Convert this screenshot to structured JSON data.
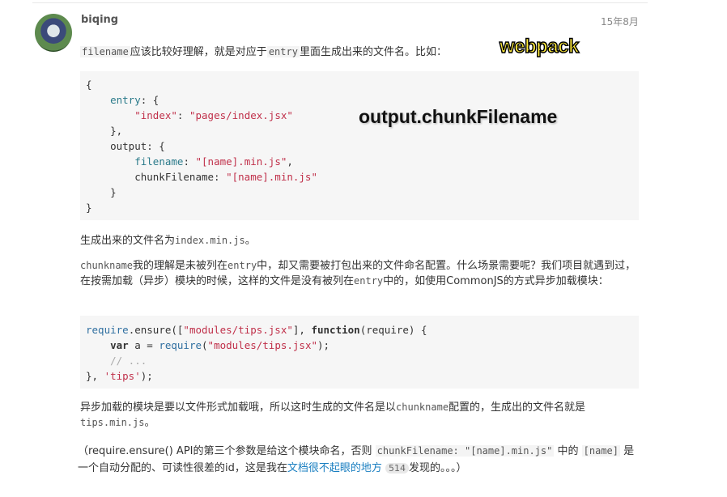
{
  "comment": {
    "author": "biqing",
    "date": "15年8月"
  },
  "p1": {
    "code1": "filename",
    "t1": "应该比较好理解，就是对应于",
    "code2": "entry",
    "t2": "里面生成出来的文件名。比如："
  },
  "code_block_1": [
    [
      {
        "t": "{",
        "c": ""
      }
    ],
    [
      {
        "t": "    ",
        "c": ""
      },
      {
        "t": "entry",
        "c": "k"
      },
      {
        "t": ": {",
        "c": ""
      }
    ],
    [
      {
        "t": "        ",
        "c": ""
      },
      {
        "t": "\"index\"",
        "c": "s"
      },
      {
        "t": ": ",
        "c": ""
      },
      {
        "t": "\"pages/index.jsx\"",
        "c": "s"
      }
    ],
    [
      {
        "t": "    },",
        "c": ""
      }
    ],
    [
      {
        "t": "    output: {",
        "c": ""
      }
    ],
    [
      {
        "t": "        ",
        "c": ""
      },
      {
        "t": "filename",
        "c": "k"
      },
      {
        "t": ": ",
        "c": ""
      },
      {
        "t": "\"[name].min.js\"",
        "c": "s"
      },
      {
        "t": ",",
        "c": ""
      }
    ],
    [
      {
        "t": "        chunkFilename: ",
        "c": ""
      },
      {
        "t": "\"[name].min.js\"",
        "c": "s"
      }
    ],
    [
      {
        "t": "    }",
        "c": ""
      }
    ],
    [
      {
        "t": "}",
        "c": ""
      }
    ]
  ],
  "p2": {
    "t1": "生成出来的文件名为",
    "code1": "index.min.js",
    "t2": "。"
  },
  "p3": {
    "code1": "chunkname",
    "t1": "我的理解是未被列在",
    "code2": "entry",
    "t2": "中，却又需要被打包出来的文件命名配置。什么场景需要呢？我们项目就遇到过，在按需加载（异步）模块的时候，这样的文件是没有被列在",
    "code3": "entry",
    "t3": "中的，如使用CommonJS的方式异步加载模块："
  },
  "code_block_2": [
    [
      {
        "t": "require",
        "c": "f"
      },
      {
        "t": ".ensure([",
        "c": ""
      },
      {
        "t": "\"modules/tips.jsx\"",
        "c": "s"
      },
      {
        "t": "], ",
        "c": ""
      },
      {
        "t": "function",
        "c": "b"
      },
      {
        "t": "(require) {",
        "c": ""
      }
    ],
    [
      {
        "t": "    ",
        "c": ""
      },
      {
        "t": "var",
        "c": "b"
      },
      {
        "t": " a = ",
        "c": ""
      },
      {
        "t": "require",
        "c": "f"
      },
      {
        "t": "(",
        "c": ""
      },
      {
        "t": "\"modules/tips.jsx\"",
        "c": "s"
      },
      {
        "t": ");",
        "c": ""
      }
    ],
    [
      {
        "t": "    ",
        "c": ""
      },
      {
        "t": "// ...",
        "c": "c"
      }
    ],
    [
      {
        "t": "}, ",
        "c": ""
      },
      {
        "t": "'tips'",
        "c": "s"
      },
      {
        "t": ");",
        "c": ""
      }
    ]
  ],
  "p4": {
    "t1": "异步加载的模块是要以文件形式加载哦，所以这时生成的文件名是以",
    "code1": "chunkname",
    "t2": "配置的，生成出的文件名就是",
    "code2": "tips.min.js",
    "t3": "。"
  },
  "p5": {
    "t1": "（require.ensure() API的第三个参数是给这个模块命名，否则 ",
    "code1": "chunkFilename: \"[name].min.js\"",
    "t2": " 中的 ",
    "code2": "[name]",
    "t3": " 是一个自动分配的、可读性很差的id，这是我在",
    "link": "文档很不起眼的地方",
    "badge": "514",
    "t4": "发现的。。。）"
  },
  "overlays": {
    "webpack": "webpack",
    "chunk": "output.chunkFilename"
  }
}
